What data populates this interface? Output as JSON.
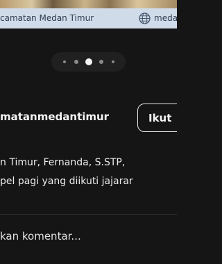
{
  "header": {
    "location_text": "camatan Medan Timur",
    "website_icon": "globe-icon",
    "website_text": "meda"
  },
  "carousel": {
    "dot_count": 5,
    "active_index": 2
  },
  "post": {
    "username": "matanmedantimur",
    "follow_label": "Ikut",
    "caption_lines": [
      "n Timur, Fernanda, S.STP,",
      "pel pagi yang diikuti jajarar"
    ]
  },
  "comment": {
    "placeholder": "kan komentar..."
  },
  "colors": {
    "background": "#151515",
    "location_bar": "#cfdbe8",
    "text": "#f4f4f4"
  }
}
